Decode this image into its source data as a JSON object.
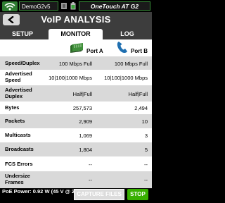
{
  "status": {
    "device_name": "DemoG2v5",
    "model_name": "OneTouch AT G2"
  },
  "header": {
    "title": "VoIP ANALYSIS"
  },
  "tabs": [
    {
      "label": "SETUP"
    },
    {
      "label": "MONITOR"
    },
    {
      "label": "LOG"
    }
  ],
  "ports": {
    "a_label": "Port A",
    "b_label": "Port B"
  },
  "rows": [
    {
      "label": "Speed/Duplex",
      "a": "100 Mbps Full",
      "b": "100 Mbps Full"
    },
    {
      "label": "Advertised Speed",
      "a": "10|100|1000 Mbps",
      "b": "10|100|1000 Mbps"
    },
    {
      "label": "Advertised Duplex",
      "a": "Half|Full",
      "b": "Half|Full"
    },
    {
      "label": "Bytes",
      "a": "257,573",
      "b": "2,494"
    },
    {
      "label": "Packets",
      "a": "2,909",
      "b": "10"
    },
    {
      "label": "Multicasts",
      "a": "1,069",
      "b": "3"
    },
    {
      "label": "Broadcasts",
      "a": "1,804",
      "b": "5"
    },
    {
      "label": "FCS Errors",
      "a": "--",
      "b": "--"
    },
    {
      "label": "Undersize Frames",
      "a": "--",
      "b": "--"
    }
  ],
  "footer": {
    "poe": "PoE Power: 0.92 W (45 V @ 20 mA, +:3,6 -:1,2)",
    "capture_label": "CAPTURE FILES",
    "stop_label": "STOP"
  },
  "colors": {
    "accent_green": "#38b000",
    "title_bg": "#3d3d3d",
    "alt_row": "#d9d9d9"
  }
}
